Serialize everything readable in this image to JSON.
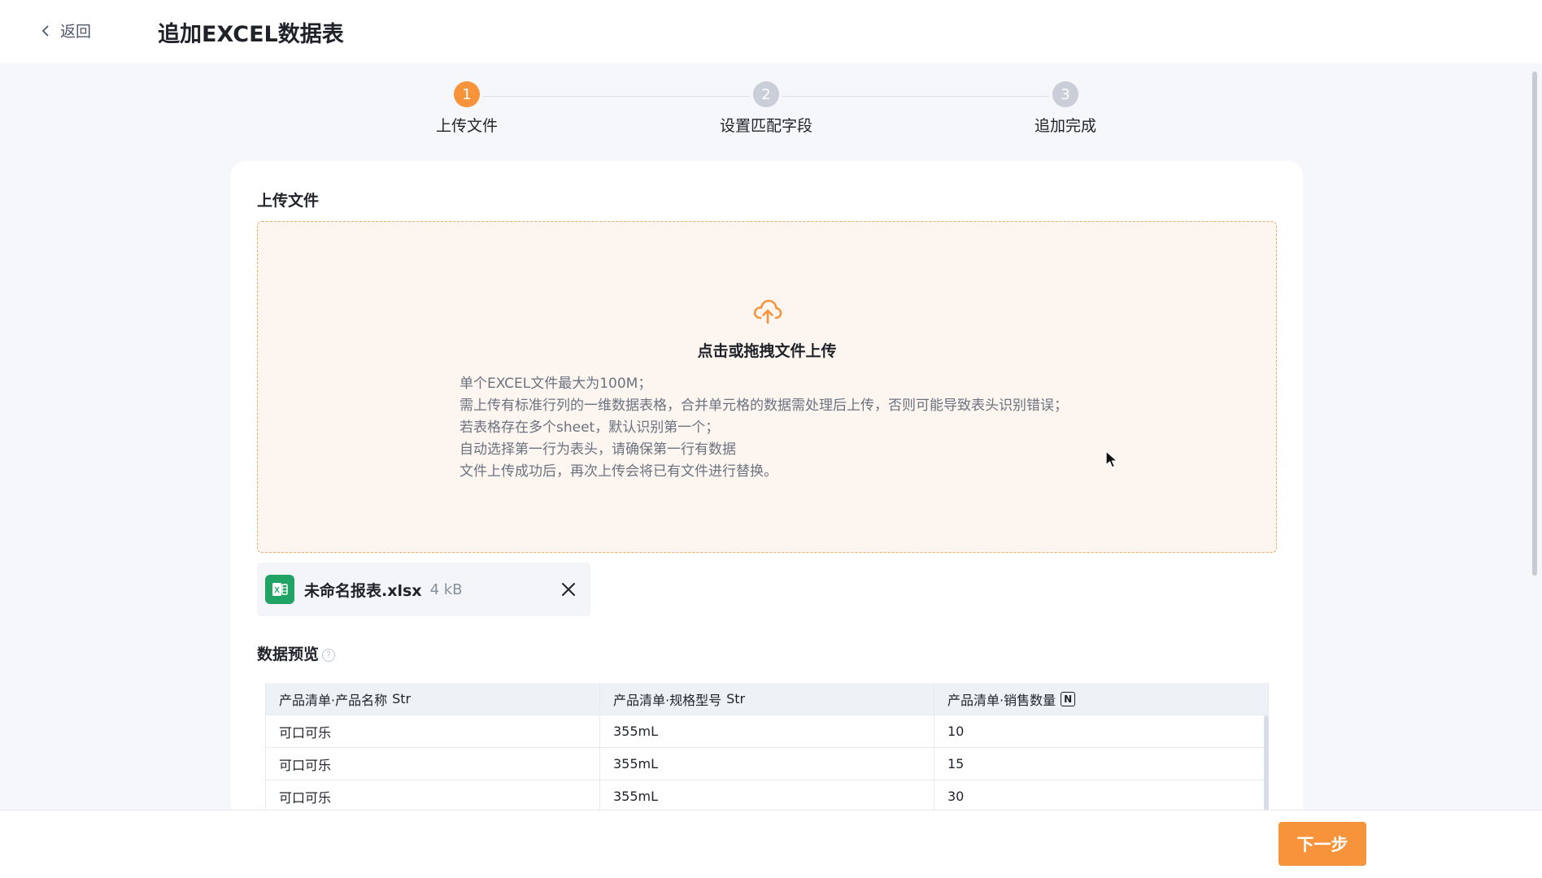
{
  "header": {
    "back_label": "返回",
    "title": "追加EXCEL数据表"
  },
  "steps": [
    {
      "number": "1",
      "label": "上传文件",
      "state": "active"
    },
    {
      "number": "2",
      "label": "设置匹配字段",
      "state": "pending"
    },
    {
      "number": "3",
      "label": "追加完成",
      "state": "pending"
    }
  ],
  "upload": {
    "section_title": "上传文件",
    "dropzone_title": "点击或拖拽文件上传",
    "tips": [
      "单个EXCEL文件最大为100M；",
      "需上传有标准行列的一维数据表格，合并单元格的数据需处理后上传，否则可能导致表头识别错误；",
      "若表格存在多个sheet，默认识别第一个；",
      "自动选择第一行为表头，请确保第一行有数据",
      "文件上传成功后，再次上传会将已有文件进行替换。"
    ]
  },
  "file": {
    "name": "未命名报表.xlsx",
    "size": "4 kB"
  },
  "preview": {
    "title": "数据预览",
    "columns": [
      {
        "label": "产品清单·产品名称",
        "type": "Str"
      },
      {
        "label": "产品清单·规格型号",
        "type": "Str"
      },
      {
        "label": "产品清单·销售数量",
        "type": "N"
      }
    ],
    "rows": [
      [
        "可口可乐",
        "355mL",
        "10"
      ],
      [
        "可口可乐",
        "355mL",
        "15"
      ],
      [
        "可口可乐",
        "355mL",
        "30"
      ]
    ]
  },
  "footer": {
    "next_label": "下一步"
  },
  "colors": {
    "accent": "#f7933b",
    "excel_green": "#21a366"
  }
}
